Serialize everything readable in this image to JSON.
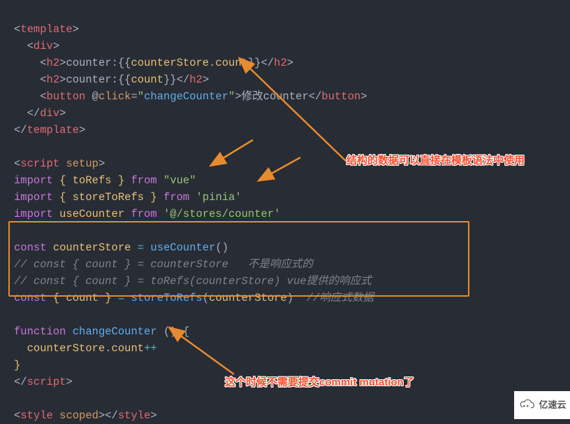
{
  "code": {
    "l1_open": "template",
    "l2_open": "div",
    "l3a_tag": "h2",
    "l3a_text": "counter:",
    "l3a_expr1": "counterStore",
    "l3a_expr2": "count",
    "l3b_tag": "h2",
    "l3b_text": "counter:",
    "l3b_expr": "count",
    "l4_tag": "button",
    "l4_ev": "click",
    "l4_handler": "changeCounter",
    "l4_text": "修改counter",
    "script_open": "script",
    "script_setup": "setup",
    "imp": "import",
    "from": "from",
    "toRefs": "toRefs",
    "vue": "\"vue\"",
    "storeToRefs": "storeToRefs",
    "pinia": "'pinia'",
    "useCounter": "useCounter",
    "counterPath": "'@/stores/counter'",
    "const": "const",
    "counterStore": "counterStore",
    "cmt1": "// const { count } = counterStore   不是响应式的",
    "cmt2": "// const { count } = toRefs(counterStore) vue提供的响应式",
    "count": "count",
    "cmt3": "//响应式数据",
    "function": "function",
    "changeCounter": "changeCounter",
    "incr_target": "counterStore",
    "incr_prop": "count",
    "style": "style",
    "scoped": "scoped"
  },
  "annotations": {
    "cap1": "结构的数据可以直接在模板语法中使用",
    "cap2": "这个时候不需要提交commit mutation了"
  },
  "watermark": "亿速云"
}
